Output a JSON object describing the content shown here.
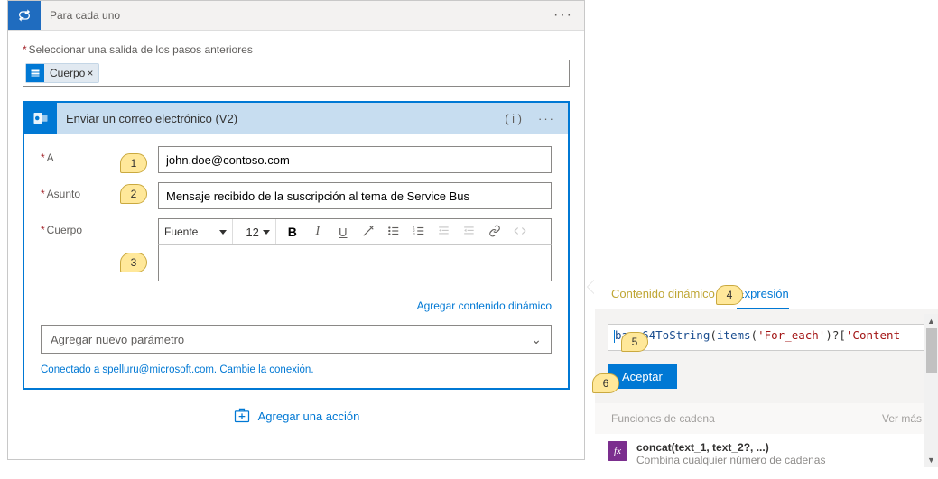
{
  "foreach": {
    "title": "Para cada uno",
    "output_label": "Seleccionar una salida de los pasos anteriores",
    "token": "Cuerpo"
  },
  "email": {
    "title": "Enviar un correo electrónico (V2)",
    "to_label": "A",
    "to_value": "john.doe@contoso.com",
    "subject_label": "Asunto",
    "subject_value": "Mensaje recibido de la suscripción al tema de Service Bus",
    "body_label": "Cuerpo",
    "font_label": "Fuente",
    "font_size": "12",
    "add_content_link": "Agregar contenido dinámico",
    "add_param_label": "Agregar nuevo parámetro",
    "connection_text": "Conectado a spelluru@microsoft.com. Cambie la conexión."
  },
  "add_action": "Agregar una acción",
  "callouts": {
    "c1": "1",
    "c2": "2",
    "c3": "3",
    "c4": "4",
    "c5": "5",
    "c6": "6"
  },
  "dyn": {
    "tab_dynamic": "Contenido dinámico",
    "tab_expression": "Expresión",
    "expression": "base64ToString(items('For_each')?['Content",
    "accept": "Aceptar",
    "section_title": "Funciones de cadena",
    "see_more": "Ver más",
    "fn_sig": "concat(text_1, text_2?, ...)",
    "fn_desc": "Combina cualquier número de cadenas"
  }
}
